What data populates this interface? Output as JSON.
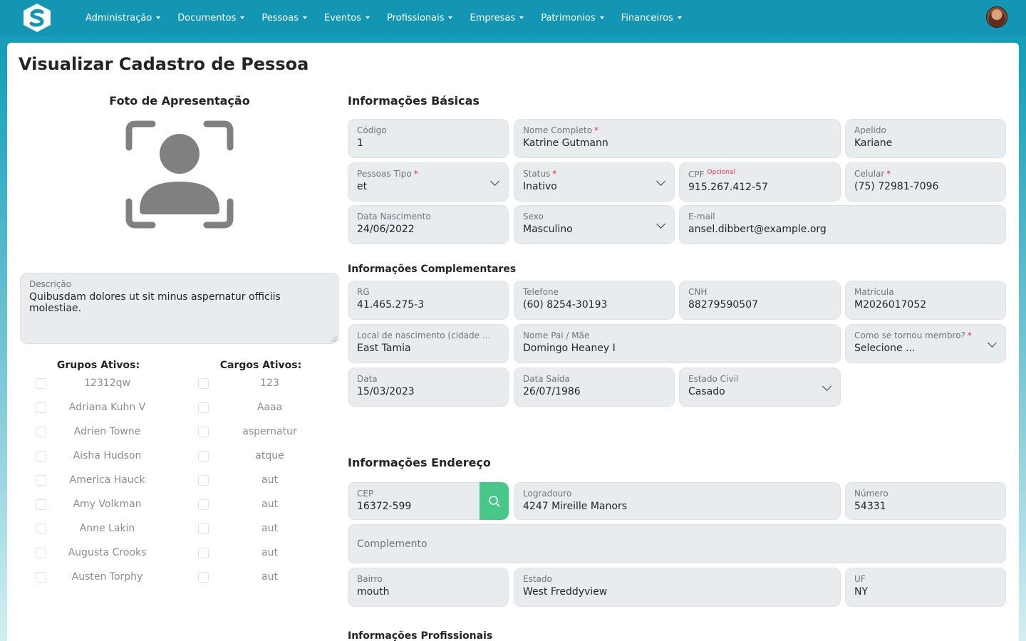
{
  "navbar": {
    "items": [
      "Administração",
      "Documentos",
      "Pessoas",
      "Eventos",
      "Profissionais",
      "Empresas",
      "Patrimonios",
      "Financeiros"
    ]
  },
  "page": {
    "title": "Visualizar Cadastro de Pessoa"
  },
  "photo": {
    "title": "Foto de Apresentação"
  },
  "description": {
    "label": "Descrição",
    "value": "Quibusdam dolores ut sit minus aspernatur officiis molestiae."
  },
  "groups": {
    "heading": "Grupos Ativos:",
    "items": [
      "12312qw",
      "Adriana Kuhn V",
      "Adrien Towne",
      "Aisha Hudson",
      "America Hauck",
      "Amy Volkman",
      "Anne Lakin",
      "Augusta Crooks",
      "Austen Torphy"
    ]
  },
  "roles": {
    "heading": "Cargos Ativos:",
    "items": [
      "123",
      "Aaaa",
      "aspernatur",
      "atque",
      "aut",
      "aut",
      "aut",
      "aut",
      "aut"
    ]
  },
  "basic": {
    "title": "Informações Básicas",
    "codigo": {
      "label": "Código",
      "value": "1"
    },
    "nome": {
      "label": "Nome Completo",
      "value": "Katrine Gutmann"
    },
    "apelido": {
      "label": "Apelido",
      "value": "Kariane"
    },
    "tipo": {
      "label": "Pessoas Tipo",
      "value": "et"
    },
    "status": {
      "label": "Status",
      "value": "Inativo"
    },
    "cpf": {
      "label": "CPF",
      "optional": "Opcional",
      "value": "915.267.412-57"
    },
    "celular": {
      "label": "Celular",
      "value": "(75) 72981-7096"
    },
    "nascimento": {
      "label": "Data Nascimento",
      "value": "24/06/2022"
    },
    "sexo": {
      "label": "Sexo",
      "value": "Masculino"
    },
    "email": {
      "label": "E-mail",
      "value": "ansel.dibbert@example.org"
    }
  },
  "complementary": {
    "title": "Informações Complementares",
    "rg": {
      "label": "RG",
      "value": "41.465.275-3"
    },
    "telefone": {
      "label": "Telefone",
      "value": "(60) 8254-30193"
    },
    "cnh": {
      "label": "CNH",
      "value": "88279590507"
    },
    "matricula": {
      "label": "Matrícula",
      "value": "M2026017052"
    },
    "local": {
      "label": "Local de nascimento (cidade ...",
      "value": "East Tamia"
    },
    "pais": {
      "label": "Nome Pai / Mãe",
      "value": "Domingo Heaney I"
    },
    "membro": {
      "label": "Como se tornou membro?",
      "value": "Selecione ..."
    },
    "data": {
      "label": "Data",
      "value": "15/03/2023"
    },
    "saida": {
      "label": "Data Saída",
      "value": "26/07/1986"
    },
    "civil": {
      "label": "Estado Civil",
      "value": "Casado"
    }
  },
  "address": {
    "title": "Informações Endereço",
    "cep": {
      "label": "CEP",
      "value": "16372-599"
    },
    "logradouro": {
      "label": "Logradouro",
      "value": "4247 Mireille Manors"
    },
    "numero": {
      "label": "Número",
      "value": "54331"
    },
    "complemento": {
      "placeholder": "Complemento"
    },
    "bairro": {
      "label": "Bairro",
      "value": "mouth"
    },
    "estado": {
      "label": "Estado",
      "value": "West Freddyview"
    },
    "uf": {
      "label": "UF",
      "value": "NY"
    }
  },
  "professional": {
    "title": "Informações Profissionais"
  },
  "colors": {
    "navbar": "#1396b4",
    "field_bg": "#e9ecef",
    "required": "#dc3545",
    "search_button": "#47c889"
  }
}
